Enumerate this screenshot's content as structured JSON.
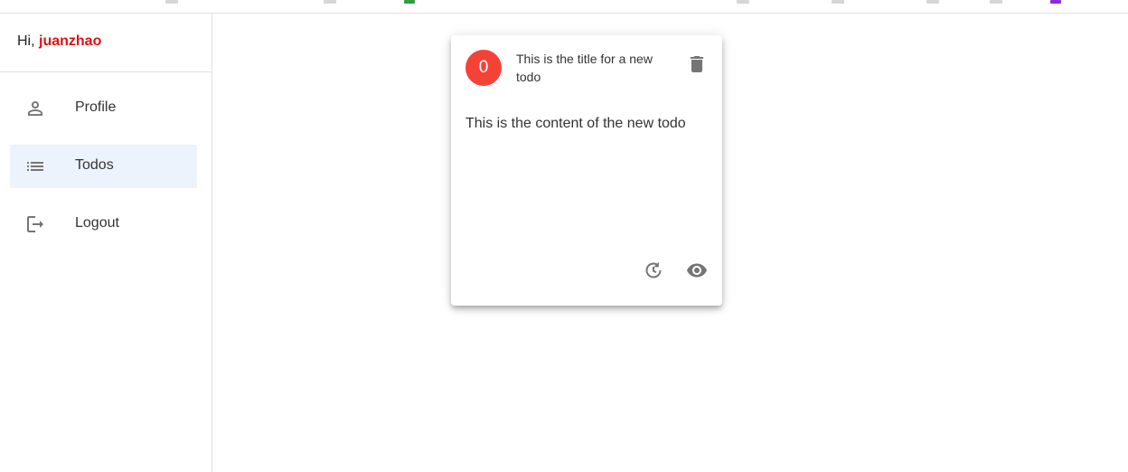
{
  "sidebar": {
    "greeting_prefix": "Hi, ",
    "username": "juanzhao",
    "items": [
      {
        "label": "Profile",
        "icon": "person-outline-icon",
        "active": false
      },
      {
        "label": "Todos",
        "icon": "list-icon",
        "active": true
      },
      {
        "label": "Logout",
        "icon": "logout-icon",
        "active": false
      }
    ]
  },
  "todo_card": {
    "avatar_text": "0",
    "title": "This is the title for a new todo",
    "content": "This is the content of the new todo",
    "avatar_color": "#f44336",
    "icons": [
      "delete-icon",
      "history-icon",
      "eye-icon"
    ]
  },
  "colors": {
    "username": "#e01010",
    "active_nav_bg": "#edf3fd",
    "icon_gray": "#757575"
  }
}
